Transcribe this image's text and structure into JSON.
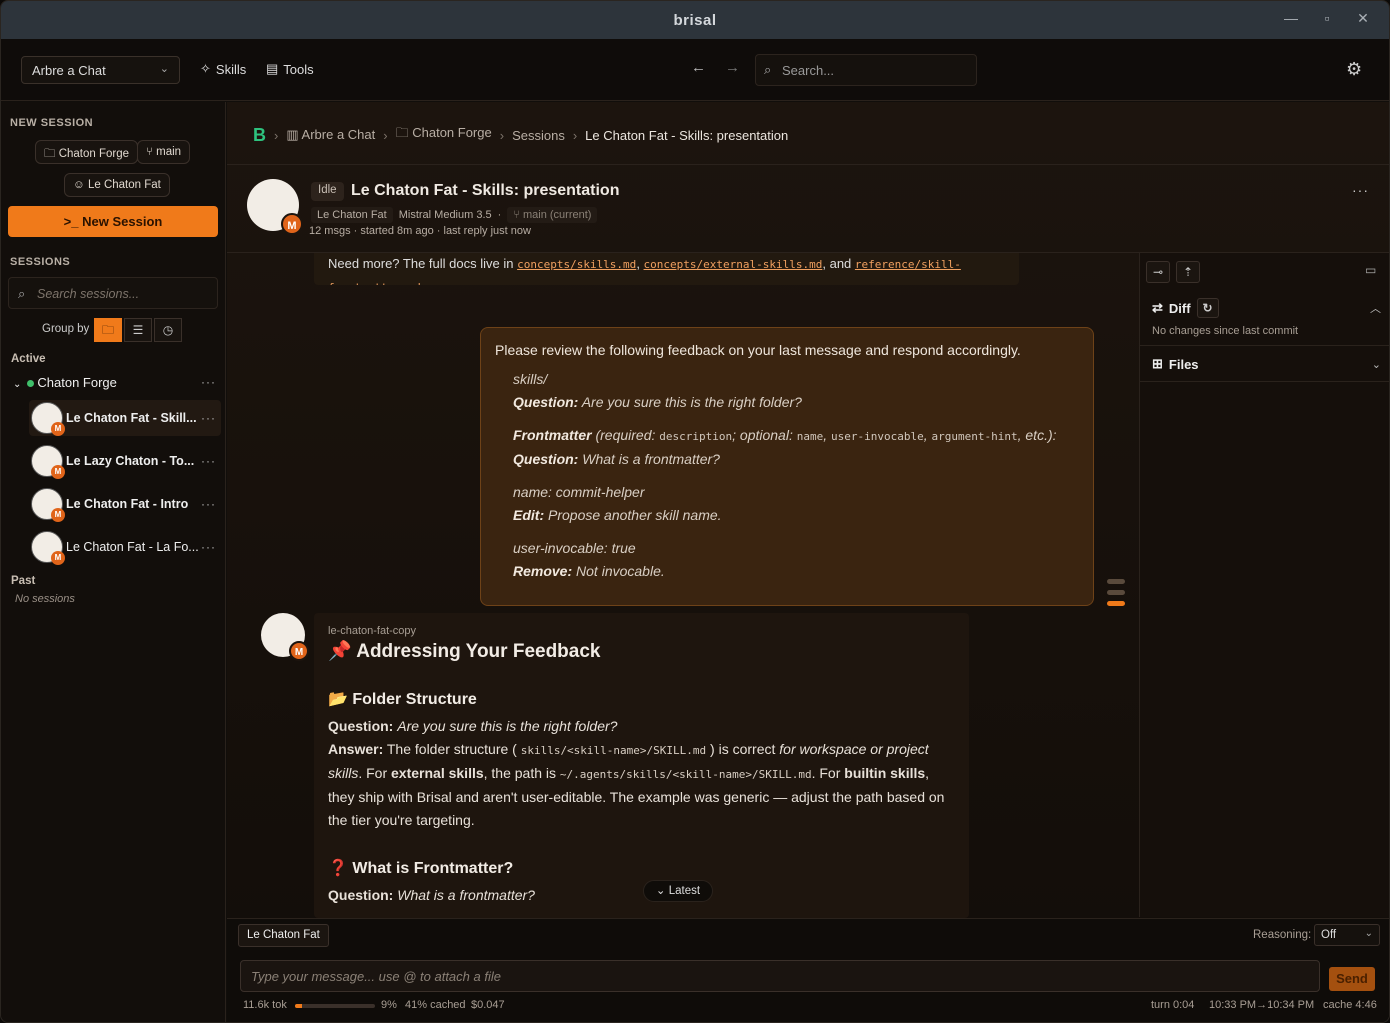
{
  "window": {
    "title": "brisal"
  },
  "topbar": {
    "project": "Arbre a Chat",
    "skills": "Skills",
    "tools": "Tools",
    "search_placeholder": "Search..."
  },
  "sidebar": {
    "new_session_label": "NEW SESSION",
    "chips": {
      "project": "Chaton Forge",
      "branch": "main",
      "agent": "Le Chaton Fat"
    },
    "new_session_button": "New Session",
    "sessions_label": "SESSIONS",
    "search_placeholder": "Search sessions...",
    "group_by": "Group by",
    "active_label": "Active",
    "active_project": "Chaton Forge",
    "sessions": [
      {
        "title": "Le Chaton Fat - Skill..."
      },
      {
        "title": "Le Lazy Chaton - To..."
      },
      {
        "title": "Le Chaton Fat - Intro"
      },
      {
        "title": "Le Chaton Fat - La Fo..."
      }
    ],
    "past_label": "Past",
    "no_sessions": "No sessions"
  },
  "breadcrumb": [
    "Arbre a Chat",
    "Chaton Forge",
    "Sessions",
    "Le Chaton Fat - Skills: presentation"
  ],
  "session": {
    "status": "Idle",
    "title": "Le Chaton Fat - Skills: presentation",
    "agent": "Le Chaton Fat",
    "model": "Mistral Medium 3.5",
    "branch": "main (current)",
    "stats": "12 msgs · started 8m ago · last reply just now"
  },
  "prev_message": {
    "text_start": "Need more? The full docs live in",
    "link1": "concepts/skills.md",
    "link2": "concepts/external-skills.md",
    "and": ", and",
    "link3": "reference/skill-frontmatter.md"
  },
  "feedback": {
    "intro": "Please review the following feedback on your last message and respond accordingly.",
    "items": [
      {
        "quote": "skills/",
        "kind": "Question:",
        "text": "Are you sure this is the right folder?"
      },
      {
        "quote_bold": "Frontmatter",
        "quote_rest": "(required:",
        "c1": "description",
        "mid": "; optional:",
        "c2": "name",
        "c3": "user-invocable",
        "c4": "argument-hint",
        "end": ", etc.):",
        "kind": "Question:",
        "text": "What is a frontmatter?"
      },
      {
        "quote": "name: commit-helper",
        "kind": "Edit:",
        "text": "Propose another skill name."
      },
      {
        "quote": "user-invocable: true",
        "kind": "Remove:",
        "text": "Not invocable."
      }
    ]
  },
  "reply": {
    "agent": "le-chaton-fat-copy",
    "h1": "📌 Addressing Your Feedback",
    "h2a": "📂 Folder Structure",
    "q1_label": "Question:",
    "q1": "Are you sure this is the right folder?",
    "a1_label": "Answer:",
    "a1_p1": "The folder structure (",
    "a1_code1": "skills/<skill-name>/SKILL.md",
    "a1_p2": ") is correct",
    "a1_em": "for workspace or project skills",
    "a1_p3": ". For",
    "a1_b1": "external skills",
    "a1_p4": ", the path is",
    "a1_code2": "~/.agents/skills/<skill-name>/SKILL.md",
    "a1_p5": ". For",
    "a1_b2": "builtin skills",
    "a1_p6": ", they ship with Brisal and aren't user-editable. The example was generic — adjust the path based on the tier you're targeting.",
    "h2b": "❓ What is Frontmatter?",
    "q2_label": "Question:",
    "q2": "What is a frontmatter?",
    "latest": "Latest"
  },
  "right_panel": {
    "diff": "Diff",
    "no_changes": "No changes since last commit",
    "files": "Files"
  },
  "composer": {
    "agent_tab": "Le Chaton Fat",
    "reasoning_label": "Reasoning:",
    "reasoning_value": "Off",
    "placeholder": "Type your message... use @ to attach a file",
    "send": "Send",
    "tokens": "11.6k tok",
    "context_pct": "9%",
    "context_fraction": 0.09,
    "cached": "41% cached",
    "cost": "$0.047",
    "turn": "turn 0:04",
    "time_range": "10:33 PM→10:34 PM",
    "cache": "cache 4:46"
  },
  "colors": {
    "accent": "#f07a1a",
    "active_dot": "#3fbf6a"
  }
}
